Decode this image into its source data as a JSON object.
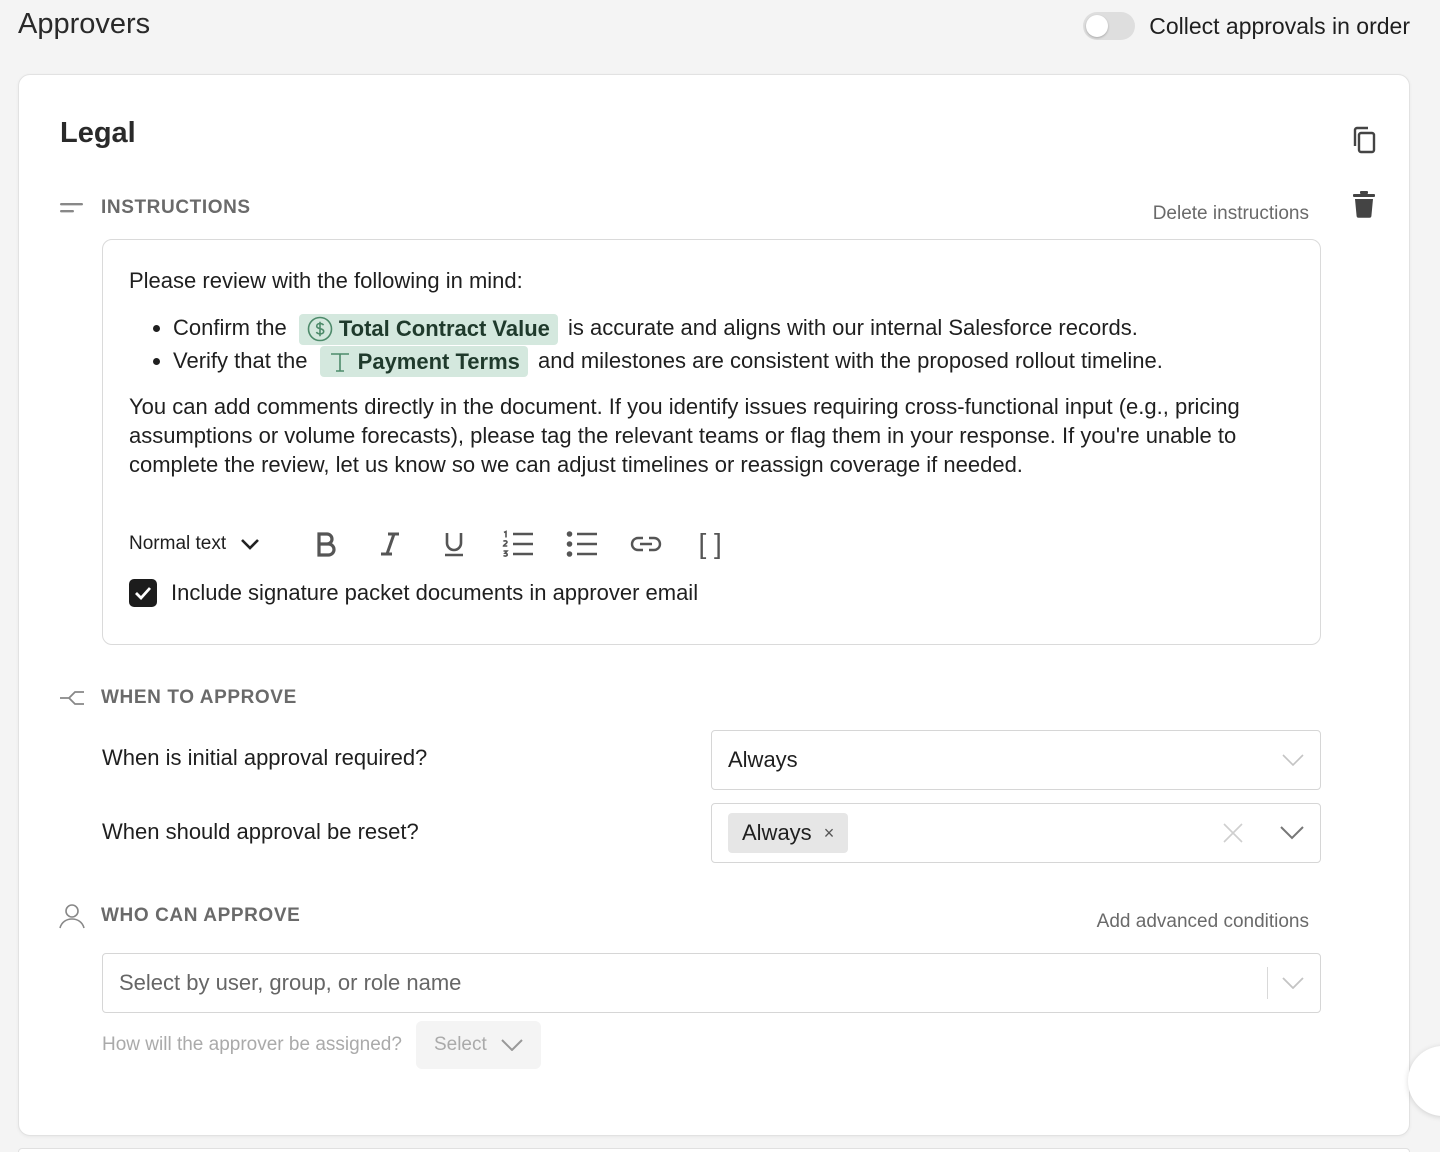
{
  "page": {
    "title": "Approvers",
    "order_toggle": {
      "label": "Collect approvals in order",
      "on": false
    }
  },
  "card": {
    "title": "Legal",
    "instructions": {
      "heading": "INSTRUCTIONS",
      "delete_link": "Delete instructions",
      "intro": "Please review with the following in mind:",
      "bullets": [
        {
          "prefix": "Confirm the",
          "chip": "Total Contract Value",
          "chip_icon": "currency-icon",
          "suffix": "is accurate and aligns with our internal Salesforce records."
        },
        {
          "prefix": "Verify that the",
          "chip": "Payment Terms",
          "chip_icon": "text-field-icon",
          "suffix": "and milestones are consistent with the proposed rollout timeline."
        }
      ],
      "body": "You can add comments directly in the document. If you identify issues requiring cross-functional input (e.g., pricing assumptions or volume forecasts), please tag the relevant teams or flag them in your response. If you're unable to complete the review, let us know so we can adjust timelines or reassign coverage if needed.",
      "toolbar": {
        "text_style": "Normal text",
        "buttons": [
          "bold",
          "italic",
          "underline",
          "ordered-list",
          "bullet-list",
          "link",
          "brackets"
        ],
        "brackets_glyph": "[ ]"
      },
      "checkbox": {
        "label": "Include signature packet documents in approver email",
        "checked": true
      }
    },
    "when": {
      "heading": "WHEN TO APPROVE",
      "initial": {
        "question": "When is initial approval required?",
        "value": "Always"
      },
      "reset": {
        "question": "When should approval be reset?",
        "tag": "Always",
        "tag_remove": "×"
      }
    },
    "who": {
      "heading": "WHO CAN APPROVE",
      "advanced_link": "Add advanced conditions",
      "placeholder": "Select by user, group, or role name",
      "assign_label": "How will the approver be assigned?",
      "assign_select": "Select"
    }
  },
  "colors": {
    "chip_bg": "#d4e8de",
    "muted_text": "#6a6a6a",
    "checkbox": "#1c1c1c"
  }
}
